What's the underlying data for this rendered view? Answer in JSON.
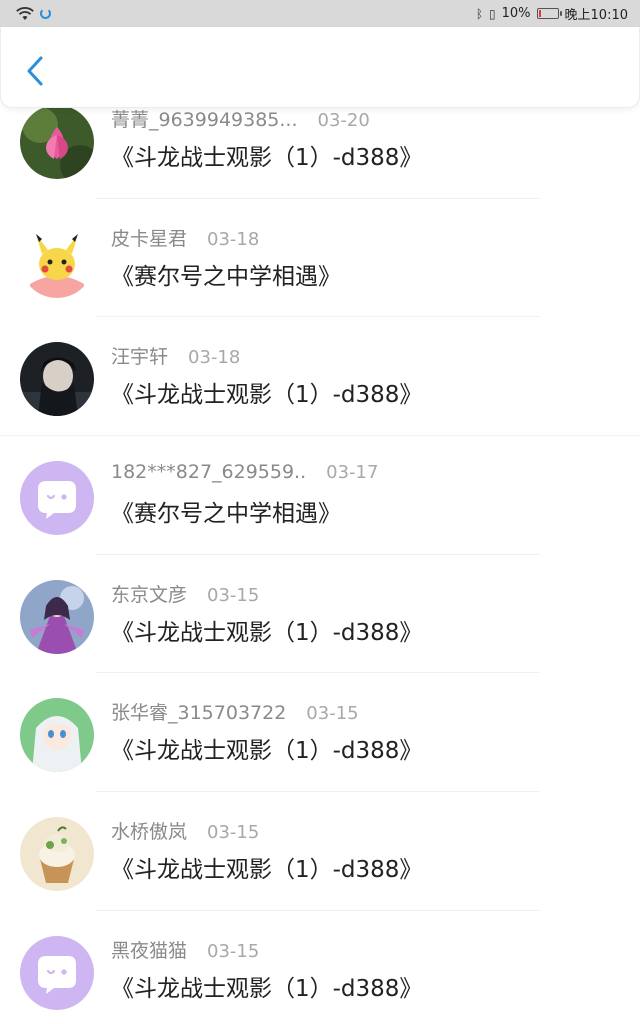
{
  "status_bar": {
    "battery_text": "10%",
    "time": "晚上10:10",
    "battery_level": 0.1,
    "battery_color": "#e03a3a"
  },
  "header": {
    "back_icon": "chevron-left-icon",
    "accent": "#2a8fd6"
  },
  "items": [
    {
      "name": "菁菁_9639949385...",
      "date": "03-20",
      "title": "《斗龙战士观影（1）-d388》",
      "avatar": "lotus-flower"
    },
    {
      "name": "皮卡星君",
      "date": "03-18",
      "title": "《赛尔号之中学相遇》",
      "avatar": "pikachu"
    },
    {
      "name": "汪宇轩",
      "date": "03-18",
      "title": "《斗龙战士观影（1）-d388》",
      "avatar": "dark-anime-boy"
    },
    {
      "name": "182***827_629559..",
      "date": "03-17",
      "title": "《赛尔号之中学相遇》",
      "avatar": "default-chat-bubble"
    },
    {
      "name": "东京文彦",
      "date": "03-15",
      "title": "《斗龙战士观影（1）-d388》",
      "avatar": "anime-warrior"
    },
    {
      "name": "张华睿_315703722",
      "date": "03-15",
      "title": "《斗龙战士观影（1）-d388》",
      "avatar": "anime-girl"
    },
    {
      "name": "水桥傲岚",
      "date": "03-15",
      "title": "《斗龙战士观影（1）-d388》",
      "avatar": "cupcake"
    },
    {
      "name": "黑夜猫猫",
      "date": "03-15",
      "title": "《斗龙战士观影（1）-d388》",
      "avatar": "default-chat-bubble"
    }
  ]
}
